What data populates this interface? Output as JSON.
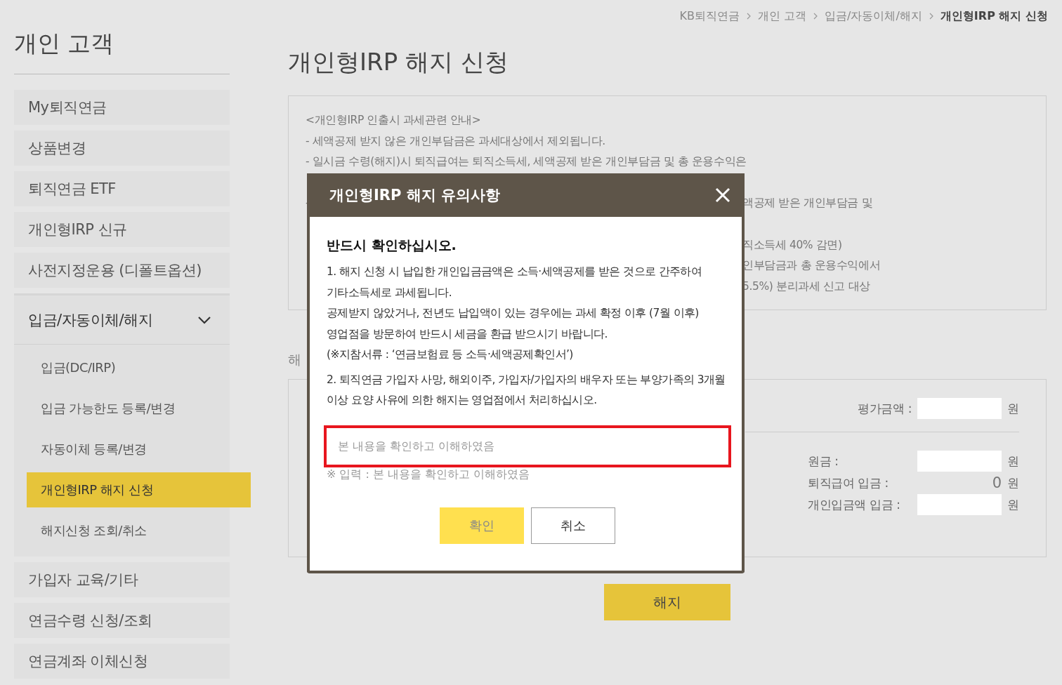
{
  "breadcrumb": [
    {
      "label": "KB퇴직연금",
      "current": false
    },
    {
      "label": "개인 고객",
      "current": false
    },
    {
      "label": "입금/자동이체/해지",
      "current": false
    },
    {
      "label": "개인형IRP 해지 신청",
      "current": true
    }
  ],
  "sidebar": {
    "title": "개인 고객",
    "items": [
      {
        "label": "My퇴직연금",
        "selected": false
      },
      {
        "label": "상품변경",
        "selected": false
      },
      {
        "label": "퇴직연금 ETF",
        "selected": false
      },
      {
        "label": "개인형IRP 신규",
        "selected": false
      },
      {
        "label": "사전지정운용 (디폴트옵션)",
        "selected": false
      },
      {
        "label": "입금/자동이체/해지",
        "selected": false,
        "expanded": true,
        "children": [
          {
            "label": "입금(DC/IRP)",
            "selected": false
          },
          {
            "label": "입금 가능한도 등록/변경",
            "selected": false
          },
          {
            "label": "자동이체 등록/변경",
            "selected": false
          },
          {
            "label": "개인형IRP 해지 신청",
            "selected": true
          },
          {
            "label": "해지신청 조회/취소",
            "selected": false
          }
        ]
      },
      {
        "label": "가입자 교육/기타",
        "selected": false
      },
      {
        "label": "연금수령 신청/조회",
        "selected": false
      },
      {
        "label": "연금계좌 이체신청",
        "selected": false
      }
    ]
  },
  "page_title": "개인형IRP 해지 신청",
  "notice_lines": [
    {
      "left": "<개인형IRP 인출시 과세관련 안내>"
    },
    {
      "left": "- 세액공제 받지 않은 개인부담금은 과세대상에서 제외됩니다."
    },
    {
      "left": "- 일시금 수령(해지)시 퇴직급여는 퇴직소득세, 세액공제 받은 개인부담금 및 총 운용수익은"
    },
    {
      "left": "-",
      "right": "액공제 받은 개인부담금 및"
    },
    {
      "right": "직소득세 40% 감면)"
    },
    {
      "right": "인부담금과 총 운용수익에서"
    },
    {
      "right": "5.5%) 분리과세 신고 대상"
    }
  ],
  "section_label": "해",
  "form": {
    "evaluation": {
      "label": "평가금액 :",
      "unit": "원"
    },
    "rows": [
      {
        "kind": "input",
        "label": "원금 :",
        "unit": "원"
      },
      {
        "kind": "text",
        "label": "퇴직급여 입금 :",
        "value": "0",
        "unit": "원"
      },
      {
        "kind": "input",
        "label": "개인입금액 입금 :",
        "unit": "원"
      }
    ],
    "submit": "해지"
  },
  "modal": {
    "title": "개인형IRP 해지 유의사항",
    "heading": "반드시 확인하십시오.",
    "paragraphs": [
      "1. 해지 신청 시 납입한 개인입금금액은 소득·세액공제를 받은 것으로 간주하여 기타소득세로 과세됩니다.\n공제받지 않았거나, 전년도 납입액이 있는 경우에는 과세 확정 이후 (7월 이후) 영업점을 방문하여 반드시 세금을 환급 받으시기 바랍니다.\n(※지참서류 : ‘연금보험료 등 소득·세액공제확인서’)",
      "2. 퇴직연금 가입자 사망, 해외이주, 가입자/가입자의 배우자 또는 부양가족의 3개월 이상 요양 사유에 의한 해지는 영업점에서 처리하십시오."
    ],
    "input": {
      "placeholder": "본 내용을 확인하고 이해하였음",
      "error": true
    },
    "hint": "※ 입력 : 본 내용을 확인하고 이해하였음",
    "buttons": [
      {
        "label": "확인",
        "kind": "primary",
        "disabled": true
      },
      {
        "label": "취소",
        "kind": "secondary",
        "disabled": false
      }
    ]
  }
}
